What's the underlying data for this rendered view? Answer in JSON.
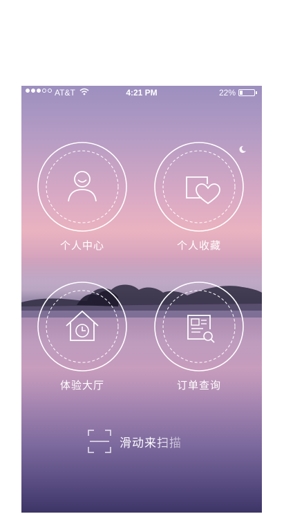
{
  "status_bar": {
    "carrier": "AT&T",
    "time": "4:21 PM",
    "battery_percent": "22%",
    "battery_level": 0.22,
    "signal_bars_filled": 3,
    "signal_bars_total": 5
  },
  "menu": {
    "profile": {
      "label": "个人中心",
      "icon": "user-icon"
    },
    "favorites": {
      "label": "个人收藏",
      "icon": "heart-folder-icon"
    },
    "experience_hall": {
      "label": "体验大厅",
      "icon": "house-clock-icon"
    },
    "orders": {
      "label": "订单查询",
      "icon": "document-search-icon"
    }
  },
  "scan": {
    "label": "滑动来扫描",
    "icon": "scan-frame-icon"
  },
  "colors": {
    "foreground": "#ffffff",
    "sky_top": "#9c8fbf",
    "sky_glow": "#eab3c0",
    "water_bottom": "#3d3566"
  }
}
